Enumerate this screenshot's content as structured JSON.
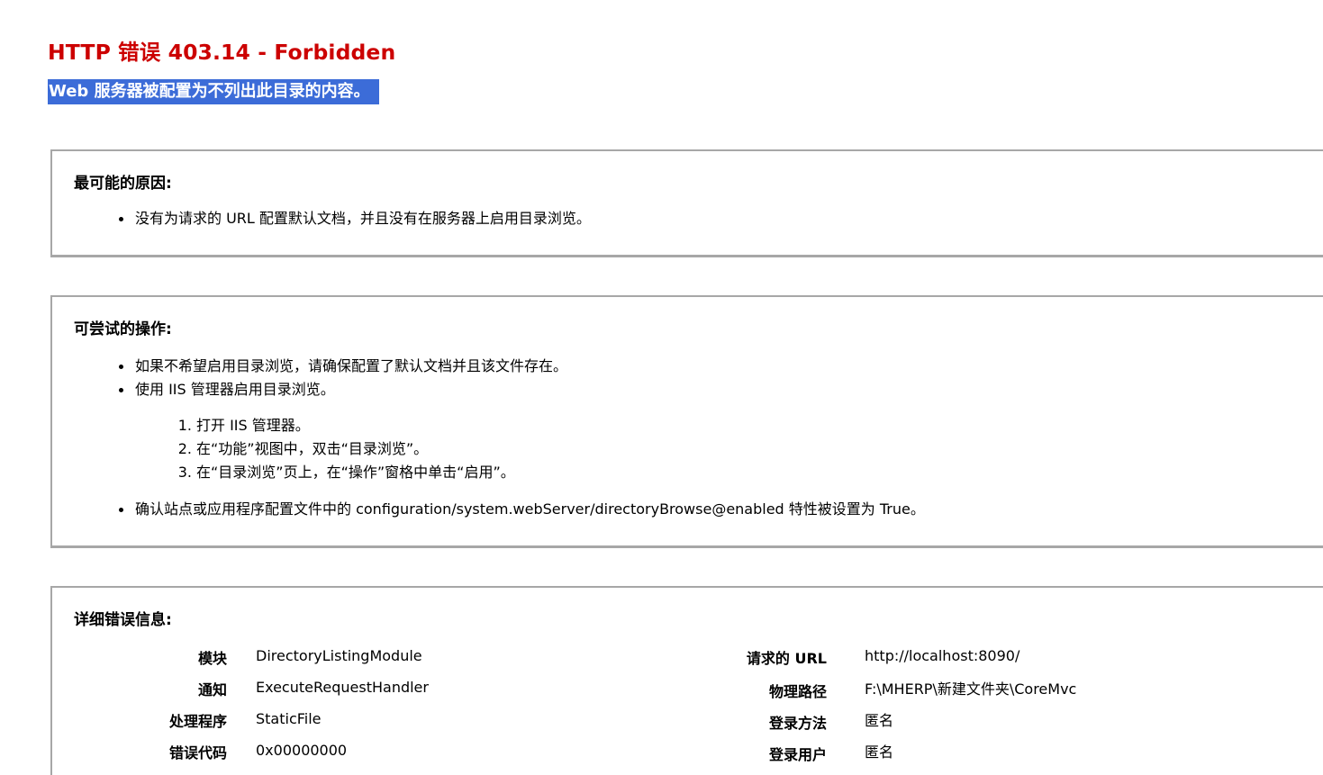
{
  "header": {
    "title": "HTTP 错误 403.14 - Forbidden",
    "subtitle": "Web 服务器被配置为不列出此目录的内容。"
  },
  "cause_box": {
    "title": "最可能的原因:",
    "items": [
      "没有为请求的 URL 配置默认文档，并且没有在服务器上启用目录浏览。"
    ]
  },
  "actions_box": {
    "title": "可尝试的操作:",
    "items": [
      "如果不希望启用目录浏览，请确保配置了默认文档并且该文件存在。",
      "使用 IIS 管理器启用目录浏览。"
    ],
    "steps": [
      {
        "num": "1.",
        "text": "打开 IIS 管理器。"
      },
      {
        "num": "2.",
        "text": "在“功能”视图中，双击“目录浏览”。"
      },
      {
        "num": "3.",
        "text": "在“目录浏览”页上，在“操作”窗格中单击“启用”。"
      }
    ],
    "last_item": "确认站点或应用程序配置文件中的 configuration/system.webServer/directoryBrowse@enabled 特性被设置为 True。"
  },
  "details_box": {
    "title": "详细错误信息:",
    "left": [
      {
        "label": "模块",
        "value": "DirectoryListingModule"
      },
      {
        "label": "通知",
        "value": "ExecuteRequestHandler"
      },
      {
        "label": "处理程序",
        "value": "StaticFile"
      },
      {
        "label": "错误代码",
        "value": "0x00000000"
      }
    ],
    "right": [
      {
        "label": "请求的 URL",
        "value": "http://localhost:8090/"
      },
      {
        "label": "物理路径",
        "value": "F:\\MHERP\\新建文件夹\\CoreMvc"
      },
      {
        "label": "登录方法",
        "value": "匿名"
      },
      {
        "label": "登录用户",
        "value": "匿名"
      }
    ]
  },
  "colors": {
    "title_red": "#cc0000",
    "subtitle_highlight": "#3c6cd8",
    "box_border": "#a7a7a7"
  }
}
